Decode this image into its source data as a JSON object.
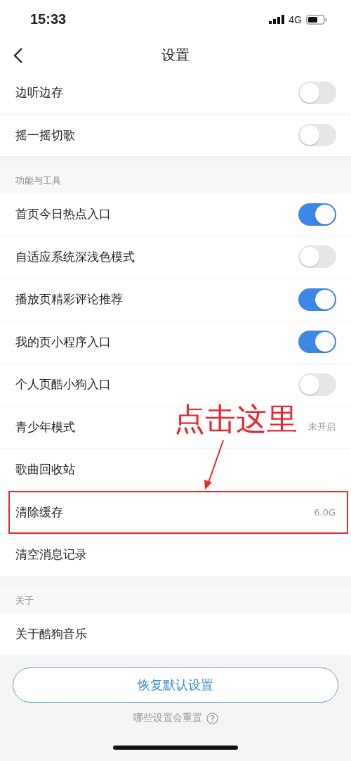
{
  "status_bar": {
    "time": "15:33",
    "network": "4G"
  },
  "nav": {
    "title": "设置"
  },
  "sections": [
    {
      "rows": [
        {
          "kind": "toggle",
          "label": "边听边存",
          "on": false
        },
        {
          "kind": "toggle",
          "label": "摇一摇切歌",
          "on": false
        }
      ]
    },
    {
      "header": "功能与工具",
      "rows": [
        {
          "kind": "toggle",
          "label": "首页今日热点入口",
          "on": true
        },
        {
          "kind": "toggle",
          "label": "自适应系统深浅色模式",
          "on": false
        },
        {
          "kind": "toggle",
          "label": "播放页精彩评论推荐",
          "on": true
        },
        {
          "kind": "toggle",
          "label": "我的页小程序入口",
          "on": true
        },
        {
          "kind": "toggle",
          "label": "个人页酷小狗入口",
          "on": false
        },
        {
          "kind": "value",
          "label": "青少年模式",
          "value": "未开启"
        },
        {
          "kind": "plain",
          "label": "歌曲回收站"
        },
        {
          "kind": "value",
          "label": "清除缓存",
          "value": "6.0G",
          "highlighted": true
        },
        {
          "kind": "plain",
          "label": "清空消息记录"
        }
      ]
    },
    {
      "header": "关于",
      "rows": [
        {
          "kind": "plain",
          "label": "关于酷狗音乐"
        }
      ]
    }
  ],
  "reset_button": "恢复默认设置",
  "reset_help": "哪些设置会重置",
  "annotation": {
    "text": "点击这里"
  }
}
